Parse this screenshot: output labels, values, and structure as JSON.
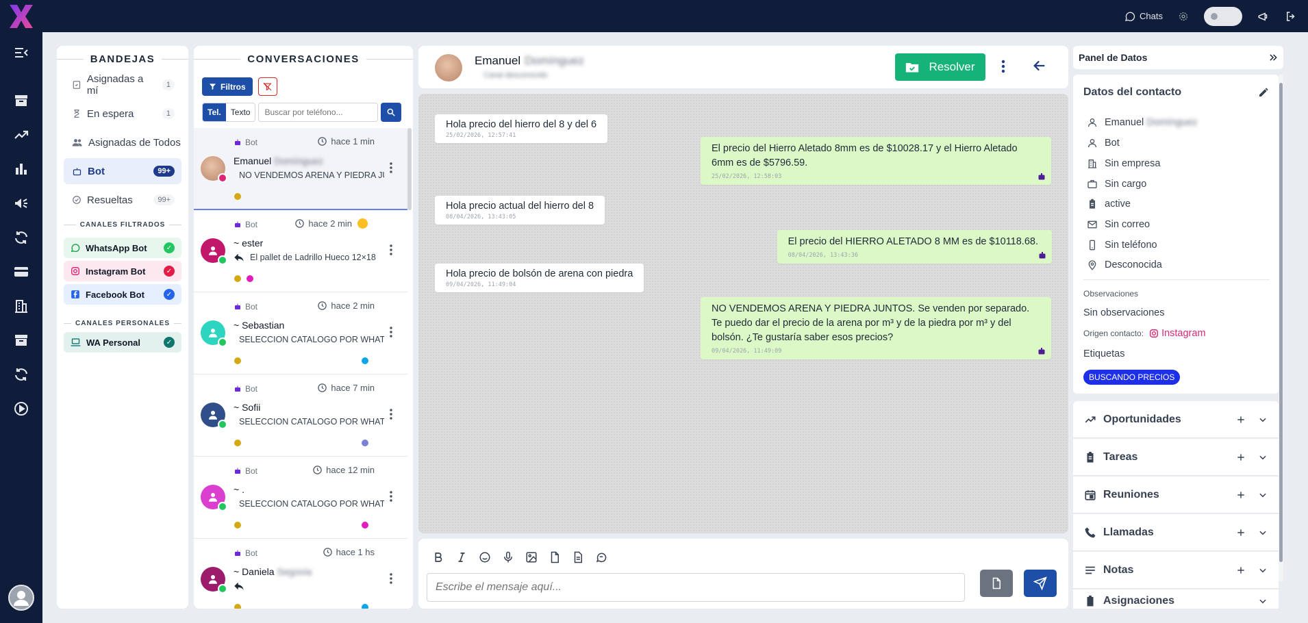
{
  "topbar": {
    "chats_label": "Chats"
  },
  "inbox": {
    "title": "BANDEJAS",
    "items": [
      {
        "label": "Asignadas a mí",
        "count": "1",
        "icon": "assigned-icon"
      },
      {
        "label": "En espera",
        "count": "1",
        "icon": "hourglass-icon"
      },
      {
        "label": "Asignadas de Todos",
        "count": "",
        "icon": "users-icon"
      },
      {
        "label": "Bot",
        "count": "99+",
        "icon": "robot-icon"
      },
      {
        "label": "Resueltas",
        "count": "99+",
        "icon": "check-circle-icon"
      }
    ],
    "filtered_title": "CANALES FILTRADOS",
    "filtered_channels": [
      {
        "label": "WhatsApp Bot",
        "color": "#e8f7ee",
        "check": "#22c55e"
      },
      {
        "label": "Instagram Bot",
        "color": "#fde8ef",
        "check": "#e11d48"
      },
      {
        "label": "Facebook Bot",
        "color": "#e5efff",
        "check": "#2563eb"
      }
    ],
    "personal_title": "CANALES PERSONALES",
    "personal_channels": [
      {
        "label": "WA Personal",
        "color": "#e3f1ee",
        "check": "#0f766e"
      }
    ]
  },
  "conversations": {
    "title": "CONVERSACIONES",
    "filter_label": "Filtros",
    "seg_phone": "Tel.",
    "seg_text": "Texto",
    "search_placeholder": "Buscar por teléfono...",
    "items": [
      {
        "source": "Bot",
        "time": "hace 1 min",
        "name": "Emanuel",
        "name_blur": "Domínguez",
        "preview": "NO VENDEMOS ARENA Y PIEDRA JUNTOS",
        "avatar": "photo",
        "channel": "instagram"
      },
      {
        "source": "Bot",
        "time": "hace 2 min",
        "name": "~ ester",
        "name_blur": "",
        "preview": "El pallet de Ladrillo Hueco 12×18",
        "avatar": "#c2186b",
        "channel": "whatsapp"
      },
      {
        "source": "Bot",
        "time": "hace 2 min",
        "name": "~ Sebastian",
        "name_blur": "",
        "preview": "SELECCION CATALOGO POR WHATSAPP",
        "avatar": "#2dd4bf",
        "channel": "whatsapp"
      },
      {
        "source": "Bot",
        "time": "hace 7 min",
        "name": "~ Sofii",
        "name_blur": "",
        "preview": "SELECCION CATALOGO POR WHATSAPP",
        "avatar": "#2f4e8a",
        "channel": "whatsapp"
      },
      {
        "source": "Bot",
        "time": "hace 12 min",
        "name": "~ .",
        "name_blur": "",
        "preview": "SELECCION CATALOGO POR WHATSAPP",
        "avatar": "#db3fd0",
        "channel": "whatsapp"
      },
      {
        "source": "Bot",
        "time": "hace 1 hs",
        "name": "~ Daniela",
        "name_blur": "Segovia",
        "preview": "",
        "avatar": "#9c1c6b",
        "channel": "whatsapp"
      }
    ]
  },
  "chat": {
    "contact_name": "Emanuel",
    "contact_name_blur": "Domínguez",
    "contact_sub_blur": "Canal desconocido",
    "resolve_label": "Resolver",
    "messages": [
      {
        "dir": "in",
        "text": "Hola precio del hierro del 8 y del 6",
        "ts": "25/02/2026, 12:57:41"
      },
      {
        "dir": "out",
        "text": "El precio del Hierro Aletado 8mm es de $10028.17 y el Hierro Aletado 6mm es de $5796.59.",
        "ts": "25/02/2026, 12:58:03"
      },
      {
        "dir": "in",
        "text": "Hola precio actual del hierro del 8",
        "ts": "08/04/2026, 13:43:05"
      },
      {
        "dir": "out",
        "text": "El precio del HIERRO ALETADO 8 MM es de $10118.68.",
        "ts": "08/04/2026, 13:43:36"
      },
      {
        "dir": "in",
        "text": "Hola precio de bolsón de arena con piedra",
        "ts": "09/04/2026, 11:49:04"
      },
      {
        "dir": "out",
        "text": "NO VENDEMOS ARENA Y PIEDRA JUNTOS. Se venden por separado. Te puedo dar el precio de la arena por m³ y de la piedra por m³ y del bolsón. ¿Te gustaría saber esos precios?",
        "ts": "09/04/2026, 11:49:09"
      }
    ],
    "input_placeholder": "Escribe el mensaje aquí..."
  },
  "data_panel": {
    "title": "Panel de Datos",
    "contact_title": "Datos del contacto",
    "name": "Emanuel",
    "name_blur": "Domínguez",
    "type": "Bot",
    "company": "Sin empresa",
    "position": "Sin cargo",
    "status": "active",
    "email": "Sin correo",
    "phone": "Sin teléfono",
    "location": "Desconocida",
    "obs_label": "Observaciones",
    "obs_value": "Sin observaciones",
    "origin_label": "Origen contacto:",
    "origin_value": "Instagram",
    "tags_label": "Etiquetas",
    "tag": "BUSCANDO PRECIOS",
    "sections": [
      "Oportunidades",
      "Tareas",
      "Reuniones",
      "Llamadas",
      "Notas",
      "Asignaciones"
    ]
  },
  "colors": {
    "navy": "#0f1c3a",
    "primary": "#1e4fa8",
    "success": "#16b378",
    "out_bubble": "#dcf8c6"
  }
}
